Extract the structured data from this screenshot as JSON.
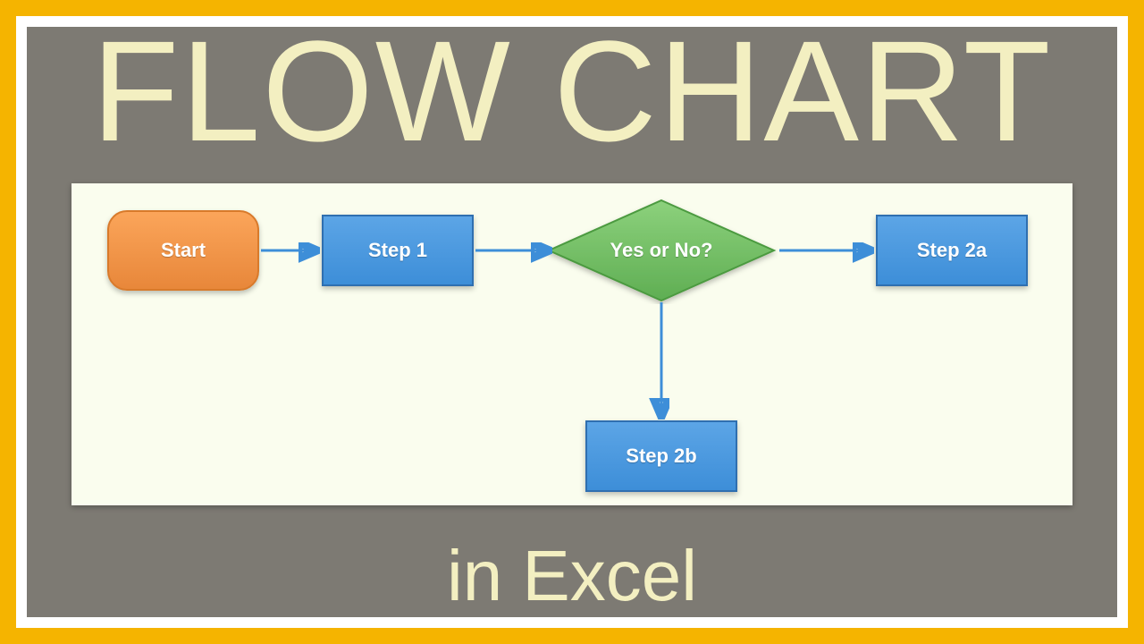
{
  "title": "FLOW CHART",
  "subtitle": "in Excel",
  "flowchart": {
    "nodes": {
      "start": {
        "label": "Start"
      },
      "step1": {
        "label": "Step 1"
      },
      "decision": {
        "label": "Yes or No?"
      },
      "step2a": {
        "label": "Step 2a"
      },
      "step2b": {
        "label": "Step 2b"
      }
    }
  },
  "colors": {
    "frame_outer": "#f5b400",
    "frame_inner": "#ffffff",
    "panel": "#7d7a73",
    "title_text": "#f3efc1",
    "canvas_bg": "#fafdee",
    "terminator_fill": "#f29146",
    "process_fill": "#4a97de",
    "decision_fill": "#6cbb60",
    "arrow": "#3d8ed8"
  }
}
